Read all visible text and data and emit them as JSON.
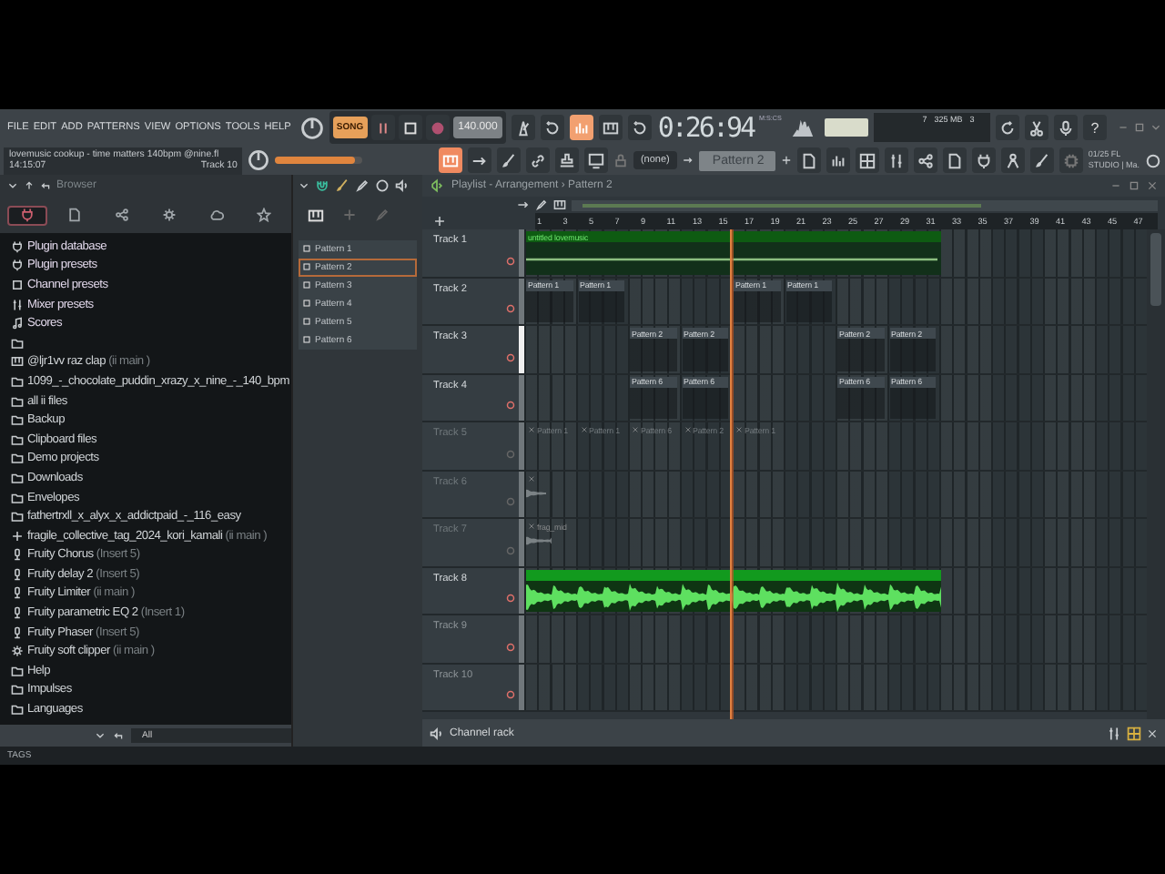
{
  "menu": [
    "FILE",
    "EDIT",
    "ADD",
    "PATTERNS",
    "VIEW",
    "OPTIONS",
    "TOOLS",
    "HELP"
  ],
  "hint": {
    "text": "lovemusic cookup - time matters 140bpm @nine.fl",
    "time": "14:15:07",
    "track": "Track 10"
  },
  "transport": {
    "mode": "SONG",
    "playing": true,
    "recording": false,
    "tempo": "140.000",
    "countdown": true
  },
  "pitch": {
    "level": 0.9
  },
  "clock": {
    "time": "0:26:94",
    "unit": "M:S:CS"
  },
  "monitor": {
    "cpu": "7",
    "memory": "325 MB",
    "polyphony": "3"
  },
  "help": "?",
  "mixer_target": "(none)",
  "pattern_selector": "Pattern 2",
  "news": [
    "01/25  FL",
    "STUDIO | Ma."
  ],
  "browser": {
    "title": "Browser",
    "filter": "All",
    "tabs": [
      {
        "kind": "all",
        "selected": true
      },
      {
        "kind": "file",
        "selected": false
      },
      {
        "kind": "share",
        "selected": false
      },
      {
        "kind": "gear",
        "selected": false
      },
      {
        "kind": "cloud",
        "selected": false
      },
      {
        "kind": "star",
        "selected": false
      }
    ],
    "items": [
      {
        "kind": "plugin",
        "label": "Plugin database"
      },
      {
        "kind": "plugin",
        "label": "Plugin presets"
      },
      {
        "kind": "channel",
        "label": "Channel presets"
      },
      {
        "kind": "mixer",
        "label": "Mixer presets"
      },
      {
        "kind": "score",
        "label": "Scores"
      },
      {
        "kind": "folder"
      },
      {
        "kind": "keys",
        "label": "@ljr1vv raz clap",
        "suffix": "(ii main )"
      },
      {
        "kind": "folder",
        "label": "1099_-_chocolate_puddin_xrazy_x_nine_-_140_bpm"
      },
      {
        "kind": "folder",
        "label": "all ii files"
      },
      {
        "kind": "folder",
        "label": "Backup"
      },
      {
        "kind": "folder",
        "label": "Clipboard files"
      },
      {
        "kind": "folder",
        "label": "Demo projects"
      },
      {
        "kind": "folder",
        "label": "Downloads"
      },
      {
        "kind": "folder",
        "label": "Envelopes"
      },
      {
        "kind": "folder",
        "label": "fathertrxll_x_alyx_x_addictpaid_-_116_easy"
      },
      {
        "kind": "generator",
        "label": "fragile_collective_tag_2024_kori_kamali",
        "suffix": "(ii main )"
      },
      {
        "kind": "effect",
        "label": "Fruity Chorus",
        "suffix": "(Insert 5)"
      },
      {
        "kind": "effect",
        "label": "Fruity delay 2",
        "suffix": "(Insert 5)"
      },
      {
        "kind": "effect",
        "label": "Fruity Limiter",
        "suffix": "(ii main )"
      },
      {
        "kind": "effect",
        "label": "Fruity parametric EQ 2",
        "suffix": "(Insert 1)"
      },
      {
        "kind": "effect",
        "label": "Fruity Phaser",
        "suffix": "(Insert 5)"
      },
      {
        "kind": "clipper",
        "label": "Fruity soft clipper",
        "suffix": "(ii main )"
      },
      {
        "kind": "folder",
        "label": "Help"
      },
      {
        "kind": "folder",
        "label": "Impulses"
      },
      {
        "kind": "folder",
        "label": "Languages"
      }
    ]
  },
  "patterns": [
    {
      "name": "Pattern 1",
      "selected": false
    },
    {
      "name": "Pattern 2",
      "selected": true
    },
    {
      "name": "Pattern 3",
      "selected": false
    },
    {
      "name": "Pattern 4",
      "selected": false
    },
    {
      "name": "Pattern 5",
      "selected": false
    },
    {
      "name": "Pattern 6",
      "selected": false
    }
  ],
  "playlist": {
    "title": "Playlist - Arrangement › Pattern 2",
    "ruler": [
      "1",
      "3",
      "5",
      "7",
      "9",
      "11",
      "13",
      "15",
      "17",
      "19",
      "21",
      "23",
      "25",
      "27",
      "29",
      "31",
      "33",
      "35",
      "37",
      "39",
      "41",
      "43",
      "45",
      "47"
    ],
    "playhead": {
      "level": 0.33
    },
    "tracks": [
      {
        "name": "Track 1",
        "muted": false,
        "selected": false,
        "clips": [
          {
            "kind": "automation",
            "label": "untitled lovemusic",
            "muted": false
          }
        ]
      },
      {
        "name": "Track 2",
        "muted": false,
        "selected": false,
        "clips": [
          {
            "kind": "pattern",
            "label": "Pattern 1",
            "muted": false
          },
          {
            "kind": "pattern",
            "label": "Pattern 1",
            "muted": false
          },
          {
            "kind": "pattern",
            "label": "Pattern 1",
            "muted": false
          },
          {
            "kind": "pattern",
            "label": "Pattern 1",
            "muted": false
          }
        ]
      },
      {
        "name": "Track 3",
        "muted": false,
        "selected": true,
        "clips": [
          {
            "kind": "pattern",
            "label": "Pattern 2",
            "muted": false
          },
          {
            "kind": "pattern",
            "label": "Pattern 2",
            "muted": false
          },
          {
            "kind": "pattern",
            "label": "Pattern 2",
            "muted": false
          },
          {
            "kind": "pattern",
            "label": "Pattern 2",
            "muted": false
          }
        ]
      },
      {
        "name": "Track 4",
        "muted": false,
        "selected": false,
        "clips": [
          {
            "kind": "pattern",
            "label": "Pattern 6",
            "muted": false
          },
          {
            "kind": "pattern",
            "label": "Pattern 6",
            "muted": false
          },
          {
            "kind": "pattern",
            "label": "Pattern 6",
            "muted": false
          },
          {
            "kind": "pattern",
            "label": "Pattern 6",
            "muted": false
          }
        ]
      },
      {
        "name": "Track 5",
        "muted": true,
        "selected": false,
        "clips": [
          {
            "kind": "pattern",
            "label": "Pattern 1",
            "muted": true
          },
          {
            "kind": "pattern",
            "label": "Pattern 1",
            "muted": true
          },
          {
            "kind": "pattern",
            "label": "Pattern 6",
            "muted": true
          },
          {
            "kind": "pattern",
            "label": "Pattern 2",
            "muted": true
          },
          {
            "kind": "pattern",
            "label": "Pattern 1",
            "muted": true
          }
        ]
      },
      {
        "name": "Track 6",
        "muted": true,
        "selected": false,
        "clips": [
          {
            "kind": "audio",
            "muted": true
          }
        ]
      },
      {
        "name": "Track 7",
        "muted": true,
        "selected": false,
        "clips": [
          {
            "kind": "audio",
            "label": "frag_mid",
            "muted": true
          }
        ]
      },
      {
        "name": "Track 8",
        "muted": false,
        "selected": false,
        "clips": [
          {
            "kind": "audio",
            "muted": false
          }
        ]
      },
      {
        "name": "Track 9",
        "muted": false,
        "selected": false
      },
      {
        "name": "Track 10",
        "muted": false,
        "selected": false
      }
    ]
  },
  "channel_rack": {
    "title": "Channel rack"
  },
  "tags": "TAGS"
}
